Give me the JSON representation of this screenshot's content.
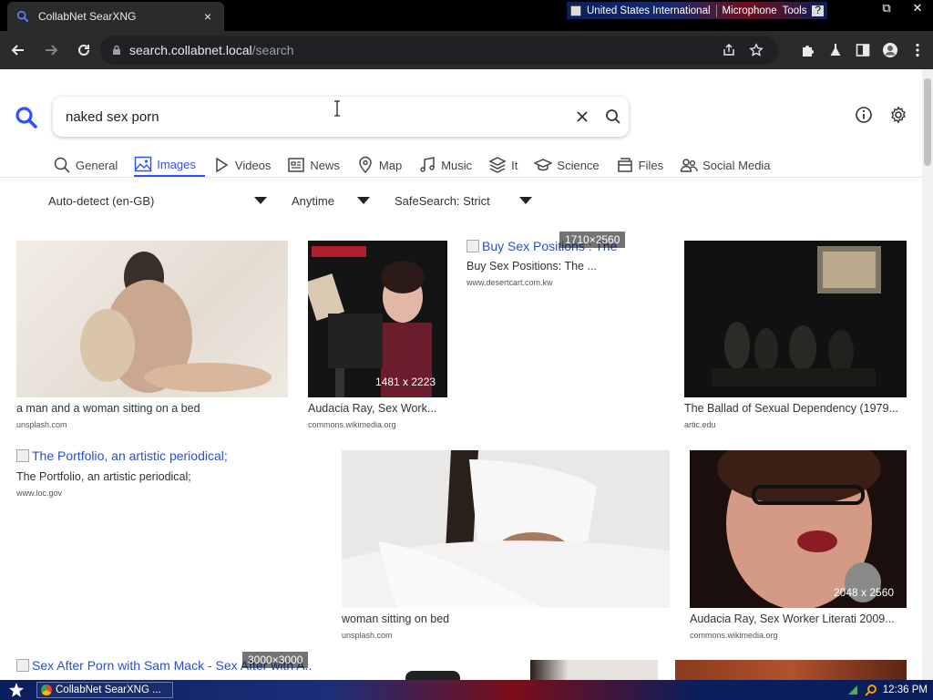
{
  "browser": {
    "tab_title": "CollabNet SearXNG",
    "tab_close": "×",
    "url_host": "search.collabnet.local",
    "url_path": "/search"
  },
  "sysbar": {
    "language": "United States International",
    "microphone": "Microphone",
    "tools": "Tools",
    "help": "?"
  },
  "window_controls": {
    "restore": "⧉",
    "close": "✕"
  },
  "search": {
    "query": "naked sex porn"
  },
  "categories": [
    {
      "label": "General",
      "icon": "search-icon"
    },
    {
      "label": "Images",
      "icon": "image-icon",
      "active": true
    },
    {
      "label": "Videos",
      "icon": "play-icon"
    },
    {
      "label": "News",
      "icon": "newspaper-icon"
    },
    {
      "label": "Map",
      "icon": "map-pin-icon"
    },
    {
      "label": "Music",
      "icon": "music-icon"
    },
    {
      "label": "It",
      "icon": "layers-icon"
    },
    {
      "label": "Science",
      "icon": "graduation-cap-icon"
    },
    {
      "label": "Files",
      "icon": "files-icon"
    },
    {
      "label": "Social Media",
      "icon": "people-icon"
    }
  ],
  "filters": {
    "language": "Auto-detect (en-GB)",
    "time": "Anytime",
    "safesearch": "SafeSearch: Strict"
  },
  "results": [
    {
      "title": "a man and a woman sitting on a bed",
      "source": "unsplash.com"
    },
    {
      "title": "Audacia Ray, Sex Work...",
      "source": "commons.wikimedia.org",
      "dims": "1481 x 2223"
    },
    {
      "alt": "Buy Sex Positions : The ...",
      "title": "Buy Sex Positions: The ...",
      "source": "www.desertcart.com.kw",
      "dims": "1710×2560"
    },
    {
      "title": "The Ballad of Sexual Dependency (1979...",
      "source": "artic.edu"
    },
    {
      "alt": "The Portfolio, an artistic periodical;",
      "title": "The Portfolio, an artistic periodical;",
      "source": "www.loc.gov"
    },
    {
      "title": "woman sitting on bed",
      "source": "unsplash.com"
    },
    {
      "title": "Audacia Ray, Sex Worker Literati 2009...",
      "source": "commons.wikimedia.org",
      "dims": "2048 x 2560"
    },
    {
      "alt": "Sex After Porn with Sam Mack - Sex After with A...",
      "dims": "3000×3000"
    }
  ],
  "taskbar": {
    "task_label": "CollabNet SearXNG ...",
    "clock": "12:36 PM"
  },
  "colors": {
    "accent": "#3050ff",
    "chrome_dark": "#2b2b2b"
  }
}
